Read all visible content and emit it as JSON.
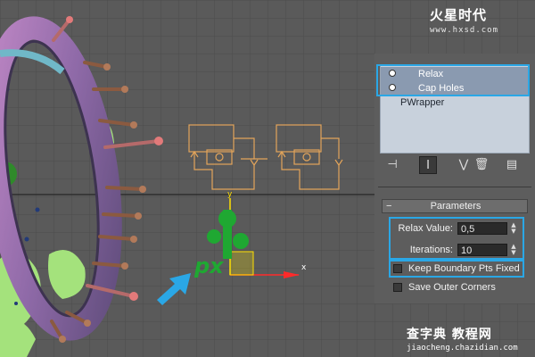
{
  "watermark_top": {
    "logo": "火星时代",
    "url": "www.hxsd.com"
  },
  "watermark_bottom": {
    "logo": "查字典 教程网",
    "url": "jiaocheng.chazidian.com"
  },
  "modifier_stack": {
    "items": [
      {
        "label": "Relax",
        "icon": "lightbulb-icon"
      },
      {
        "label": "Cap Holes",
        "icon": "lightbulb-icon"
      },
      {
        "label": "PWrapper"
      }
    ]
  },
  "toolbar": {
    "buttons": [
      {
        "icon": "pin-stack-icon",
        "glyph": "⊣"
      },
      {
        "icon": "show-end-result-icon",
        "glyph": "I"
      },
      {
        "icon": "make-unique-icon",
        "glyph": "⋁"
      },
      {
        "icon": "remove-modifier-icon",
        "glyph": "🗑"
      },
      {
        "icon": "configure-modifier-sets-icon",
        "glyph": "▤"
      }
    ]
  },
  "parameters": {
    "header": "Parameters",
    "collapse_glyph": "−",
    "relax_value": {
      "label": "Relax Value:",
      "value": "0,5"
    },
    "iterations": {
      "label": "Iterations:",
      "value": "10"
    },
    "keep_boundary": {
      "label": "Keep Boundary Pts Fixed",
      "checked": false
    },
    "save_outer_corners": {
      "label": "Save Outer Corners",
      "checked": false
    }
  },
  "viewport": {
    "axis_x_label": "x",
    "axis_y_label": "y",
    "highlight_color": "#2aa7e6"
  }
}
